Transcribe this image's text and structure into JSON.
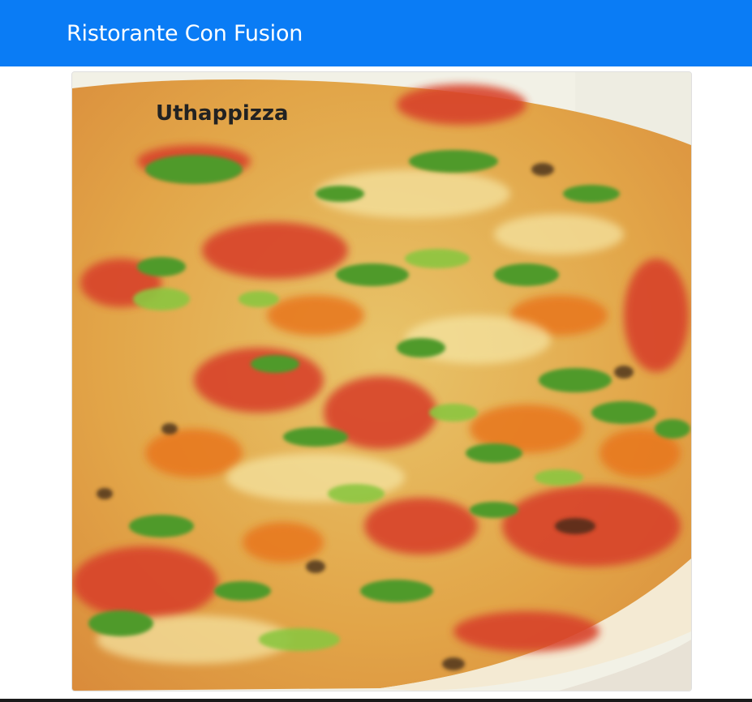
{
  "navbar": {
    "brand": "Ristorante Con Fusion",
    "color": "#0a7cf5"
  },
  "dish_card": {
    "title": "Uthappizza",
    "image_alt": "Uthappizza",
    "image_subject": "pizza-photo"
  }
}
